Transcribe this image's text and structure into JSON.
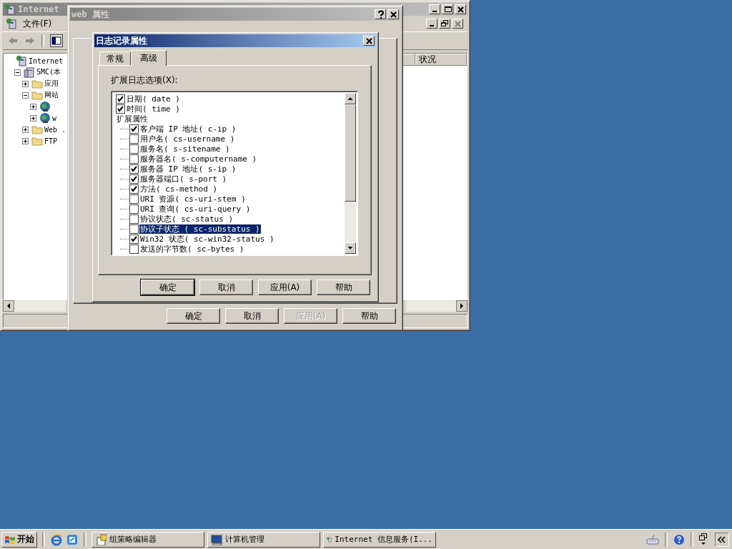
{
  "main_window": {
    "title": "Internet",
    "menu": [
      "文件(F)"
    ],
    "columns": [
      "状况"
    ],
    "tree": [
      {
        "kind": "root",
        "label": "Internet",
        "children": [
          {
            "kind": "server",
            "label": "SMC(本",
            "expanded": true,
            "children": [
              {
                "kind": "folder",
                "label": "应用",
                "expanded": false
              },
              {
                "kind": "folder",
                "label": "网站",
                "expanded": true,
                "children": [
                  {
                    "kind": "site",
                    "expanded": false
                  },
                  {
                    "kind": "site",
                    "label": "w",
                    "expanded": false
                  }
                ]
              },
              {
                "kind": "folder",
                "label": "Web .",
                "expanded": false
              },
              {
                "kind": "folder",
                "label": "FTP",
                "expanded": false
              }
            ]
          }
        ]
      }
    ]
  },
  "web_dialog": {
    "title": "web 属性",
    "buttons": [
      {
        "label": "确定",
        "disabled": false
      },
      {
        "label": "取消",
        "disabled": false
      },
      {
        "label": "应用(A)",
        "disabled": true
      },
      {
        "label": "帮助",
        "disabled": false
      }
    ]
  },
  "log_dialog": {
    "title": "日志记录属性",
    "tabs": [
      {
        "label": "常规",
        "selected": false
      },
      {
        "label": "高级",
        "selected": true
      }
    ],
    "options_label": "扩展日志选项(X):",
    "options": [
      {
        "kind": "check",
        "label": "日期( date )",
        "checked": true
      },
      {
        "kind": "check",
        "label": "时间( time )",
        "checked": true
      },
      {
        "kind": "group",
        "label": "扩展属性",
        "children": [
          {
            "label": "客户端 IP 地址( c-ip )",
            "checked": true,
            "selected": false
          },
          {
            "label": "用户名( cs-username )",
            "checked": false,
            "selected": false
          },
          {
            "label": "服务名( s-sitename )",
            "checked": false,
            "selected": false
          },
          {
            "label": "服务器名( s-computername )",
            "checked": false,
            "selected": false
          },
          {
            "label": "服务器 IP 地址( s-ip )",
            "checked": true,
            "selected": false
          },
          {
            "label": "服务器端口( s-port )",
            "checked": true,
            "selected": false
          },
          {
            "label": "方法( cs-method )",
            "checked": true,
            "selected": false
          },
          {
            "label": "URI 资源( cs-uri-stem )",
            "checked": false,
            "selected": false
          },
          {
            "label": "URI 查询( cs-uri-query )",
            "checked": false,
            "selected": false
          },
          {
            "label": "协议状态( sc-status )",
            "checked": false,
            "selected": false
          },
          {
            "label": "协议子状态 ( sc-substatus )",
            "checked": false,
            "selected": true
          },
          {
            "label": "Win32 状态( sc-win32-status )",
            "checked": true,
            "selected": false
          },
          {
            "label": "发送的字节数( sc-bytes )",
            "checked": false,
            "selected": false
          }
        ]
      }
    ],
    "buttons": [
      {
        "label": "确定",
        "default": true
      },
      {
        "label": "取消",
        "default": false
      },
      {
        "label": "应用(A)",
        "default": false
      },
      {
        "label": "帮助",
        "default": false
      }
    ]
  },
  "taskbar": {
    "start": "开始",
    "tasks": [
      {
        "label": "组策略编辑器",
        "kind": "policy",
        "selected": false
      },
      {
        "label": "计算机管理",
        "kind": "computer",
        "selected": false
      },
      {
        "label": "Internet 信息服务(I...",
        "kind": "iis",
        "selected": false
      }
    ]
  }
}
